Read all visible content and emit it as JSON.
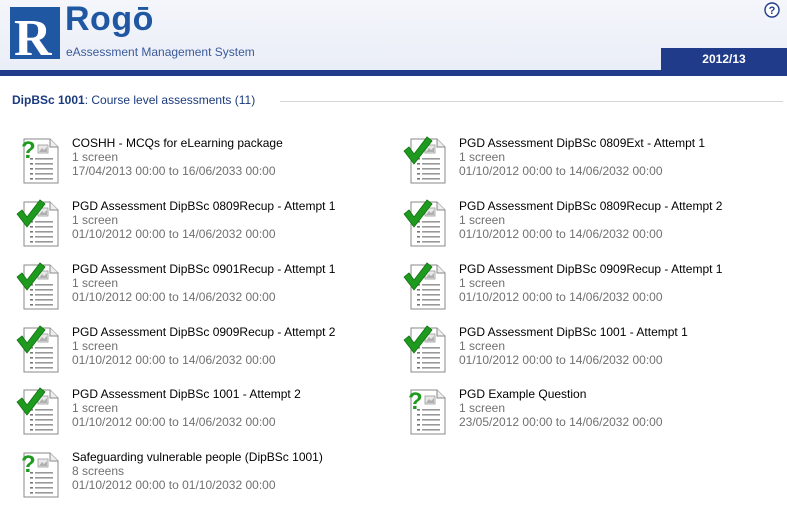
{
  "header": {
    "app_name": "Rogō",
    "app_subtitle": "eAssessment Management System",
    "year": "2012/13",
    "logo_letter": "R",
    "brand_color": "#1f3b8a"
  },
  "section": {
    "code": "DipBSc 1001",
    "rest": ": Course level assessments (11)"
  },
  "items": [
    {
      "status": "question-mark",
      "title": "COSHH - MCQs for eLearning package",
      "screens": "1 screen",
      "dates": "17/04/2013 00:00 to 16/06/2033 00:00"
    },
    {
      "status": "checkmark",
      "title": "PGD Assessment DipBSc 0809Ext - Attempt 1",
      "screens": "1 screen",
      "dates": "01/10/2012 00:00 to 14/06/2032 00:00"
    },
    {
      "status": "checkmark",
      "title": "PGD Assessment DipBSc 0809Recup - Attempt 1",
      "screens": "1 screen",
      "dates": "01/10/2012 00:00 to 14/06/2032 00:00"
    },
    {
      "status": "checkmark",
      "title": "PGD Assessment DipBSc 0809Recup - Attempt 2",
      "screens": "1 screen",
      "dates": "01/10/2012 00:00 to 14/06/2032 00:00"
    },
    {
      "status": "checkmark",
      "title": "PGD Assessment DipBSc 0901Recup - Attempt 1",
      "screens": "1 screen",
      "dates": "01/10/2012 00:00 to 14/06/2032 00:00"
    },
    {
      "status": "checkmark",
      "title": "PGD Assessment DipBSc 0909Recup - Attempt 1",
      "screens": "1 screen",
      "dates": "01/10/2012 00:00 to 14/06/2032 00:00"
    },
    {
      "status": "checkmark",
      "title": "PGD Assessment DipBSc 0909Recup - Attempt 2",
      "screens": "1 screen",
      "dates": "01/10/2012 00:00 to 14/06/2032 00:00"
    },
    {
      "status": "checkmark",
      "title": "PGD Assessment DipBSc 1001 - Attempt 1",
      "screens": "1 screen",
      "dates": "01/10/2012 00:00 to 14/06/2032 00:00"
    },
    {
      "status": "checkmark",
      "title": "PGD Assessment DipBSc 1001 - Attempt 2",
      "screens": "1 screen",
      "dates": "01/10/2012 00:00 to 14/06/2032 00:00"
    },
    {
      "status": "question-mark",
      "title": "PGD Example Question",
      "screens": "1 screen",
      "dates": "23/05/2012 00:00 to 14/06/2032 00:00"
    },
    {
      "status": "question-mark",
      "title": "Safeguarding vulnerable people (DipBSc 1001)",
      "screens": "8 screens",
      "dates": "01/10/2012 00:00 to 01/10/2032 00:00"
    }
  ]
}
